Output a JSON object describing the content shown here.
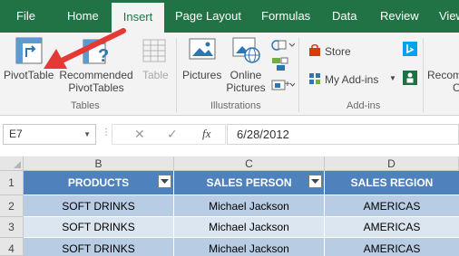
{
  "ribbon_tabs": [
    {
      "label": "File"
    },
    {
      "label": "Home"
    },
    {
      "label": "Insert",
      "active": true
    },
    {
      "label": "Page Layout"
    },
    {
      "label": "Formulas"
    },
    {
      "label": "Data"
    },
    {
      "label": "Review"
    },
    {
      "label": "View"
    }
  ],
  "ribbon": {
    "tables_group": {
      "label": "Tables",
      "pivottable": "PivotTable",
      "recommended_line1": "Recommended",
      "recommended_line2": "PivotTables",
      "table": "Table"
    },
    "illustrations_group": {
      "label": "Illustrations",
      "pictures": "Pictures",
      "online_line1": "Online",
      "online_line2": "Pictures"
    },
    "addins_group": {
      "label": "Add-ins",
      "store": "Store",
      "my_addins": "My Add-ins"
    },
    "recommended_charts_partial_line1": "Recom",
    "recommended_charts_partial_line2": "C"
  },
  "formula_bar": {
    "name_box": "E7",
    "fx_label": "fx",
    "value": "6/28/2012"
  },
  "sheet": {
    "columns": [
      "B",
      "C",
      "D"
    ],
    "rows": [
      "1",
      "2",
      "3",
      "4"
    ],
    "headers": [
      "PRODUCTS",
      "SALES PERSON",
      "SALES REGION"
    ],
    "data": [
      [
        "SOFT DRINKS",
        "Michael Jackson",
        "AMERICAS"
      ],
      [
        "SOFT DRINKS",
        "Michael Jackson",
        "AMERICAS"
      ],
      [
        "SOFT DRINKS",
        "Michael Jackson",
        "AMERICAS"
      ]
    ]
  },
  "colors": {
    "ribbon_green": "#217346",
    "table_header": "#4f81bd",
    "band_dark": "#b8cce4",
    "band_light": "#dce6f1",
    "arrow": "#e53935"
  },
  "icons": [
    "pivottable-icon",
    "recommended-pivottables-icon",
    "table-icon",
    "pictures-icon",
    "online-pictures-icon",
    "shapes-icon",
    "store-icon",
    "my-addins-icon",
    "bing-icon",
    "people-graph-icon",
    "red-arrow-annotation"
  ]
}
